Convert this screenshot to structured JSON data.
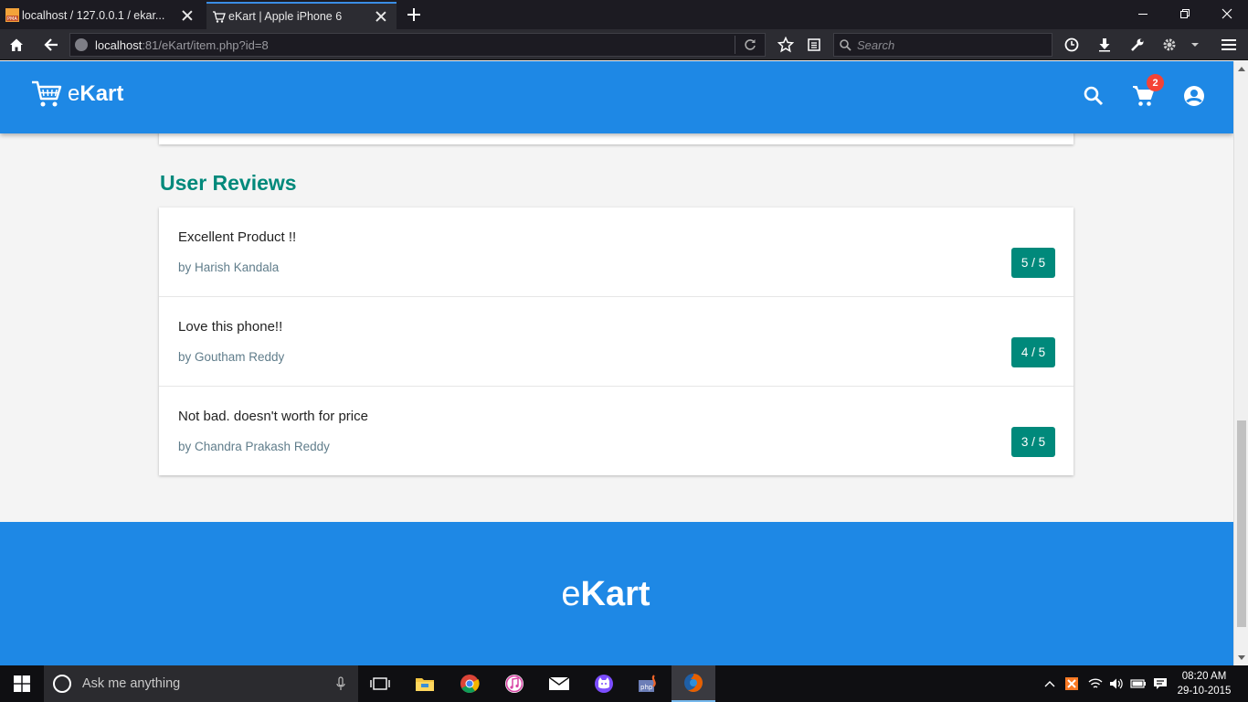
{
  "browser": {
    "tabs": [
      {
        "label": "localhost / 127.0.0.1 / ekar..."
      },
      {
        "label": "eKart | Apple iPhone 6"
      }
    ],
    "url_host": "localhost",
    "url_rest": ":81/eKart/item.php?id=8",
    "search_placeholder": "Search"
  },
  "header": {
    "brand_prefix": "e",
    "brand_bold": "Kart",
    "cart_count": "2"
  },
  "reviews_section": {
    "title": "User Reviews",
    "reviews": [
      {
        "title": "Excellent Product !!",
        "author": "by Harish Kandala",
        "score": "5 / 5"
      },
      {
        "title": "Love this phone!!",
        "author": "by Goutham Reddy",
        "score": "4 / 5"
      },
      {
        "title": "Not bad. doesn't worth for price",
        "author": "by Chandra Prakash Reddy",
        "score": "3 / 5"
      }
    ]
  },
  "footer": {
    "brand_prefix": "e",
    "brand_bold": "Kart"
  },
  "taskbar": {
    "search_placeholder": "Ask me anything",
    "time": "08:20 AM",
    "date": "29-10-2015",
    "apps": [
      "file-explorer-icon",
      "chrome-icon",
      "itunes-icon",
      "mail-icon",
      "cat-app-icon",
      "php-icon",
      "firefox-icon"
    ]
  },
  "colors": {
    "primary": "#1e88e5",
    "accent": "#00897b",
    "badge": "#f44336"
  }
}
